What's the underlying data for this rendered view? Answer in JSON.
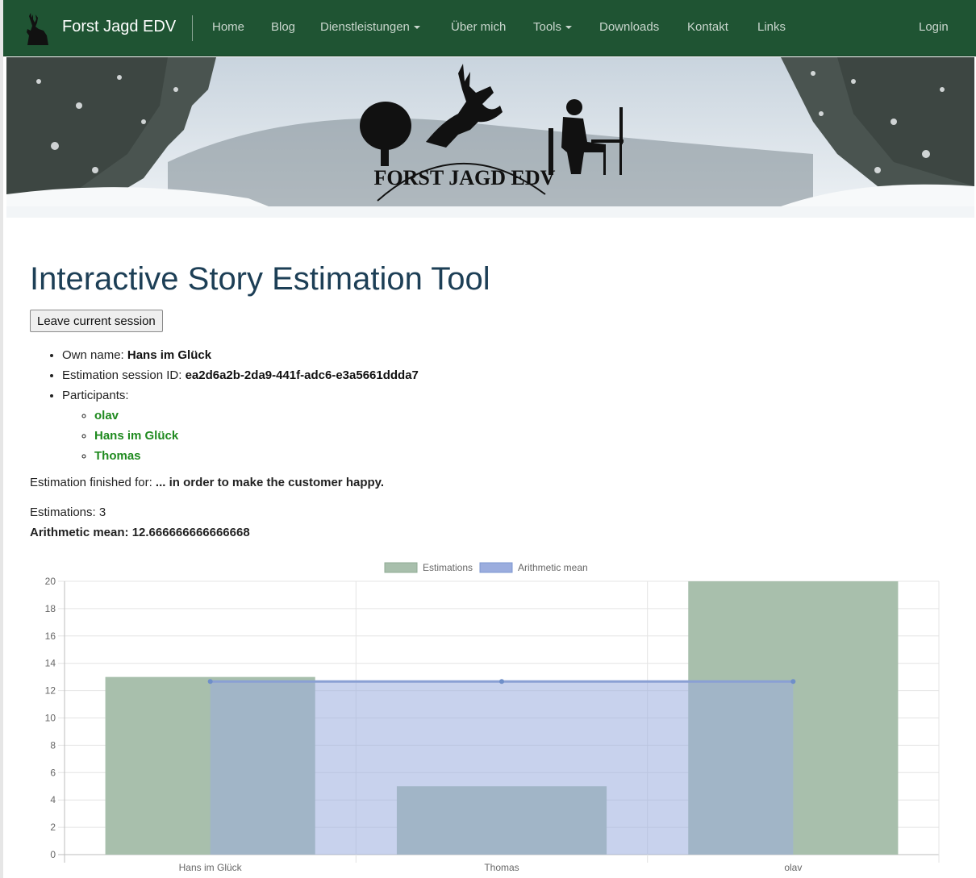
{
  "nav": {
    "brand": "Forst Jagd EDV",
    "items": [
      {
        "label": "Home",
        "dropdown": false
      },
      {
        "label": "Blog",
        "dropdown": false
      },
      {
        "label": "Dienstleistungen",
        "dropdown": true
      },
      {
        "label": "Über mich",
        "dropdown": false
      },
      {
        "label": "Tools",
        "dropdown": true
      },
      {
        "label": "Downloads",
        "dropdown": false
      },
      {
        "label": "Kontakt",
        "dropdown": false
      },
      {
        "label": "Links",
        "dropdown": false
      }
    ],
    "login": "Login"
  },
  "banner": {
    "logo_text": "FORST JAGD EDV"
  },
  "main": {
    "title": "Interactive Story Estimation Tool",
    "leave_button": "Leave current session",
    "own_name_label": "Own name:",
    "own_name": "Hans im Glück",
    "session_label": "Estimation session ID:",
    "session_id": "ea2d6a2b-2da9-441f-adc6-e3a5661ddda7",
    "participants_label": "Participants:",
    "participants": [
      "olav",
      "Hans im Glück",
      "Thomas"
    ],
    "finished_label": "Estimation finished for:",
    "finished_story": "... in order to make the customer happy.",
    "estimations_count": "Estimations: 3",
    "arithmetic_mean": "Arithmetic mean: 12.666666666666668"
  },
  "colors": {
    "navbar": "#1f5433",
    "title": "#1d3f56",
    "participant_link": "#1f8a1f",
    "series_estimations": "#a8bfac",
    "series_mean": "#9badde"
  },
  "chart_data": {
    "type": "bar",
    "categories": [
      "Hans im Glück",
      "Thomas",
      "olav"
    ],
    "series": [
      {
        "name": "Estimations",
        "type": "bar",
        "values": [
          13,
          5,
          20
        ]
      },
      {
        "name": "Arithmetic mean",
        "type": "area",
        "values": [
          12.666666666666668,
          12.666666666666668,
          12.666666666666668
        ]
      }
    ],
    "ylim": [
      0,
      20
    ],
    "yticks": [
      0,
      2,
      4,
      6,
      8,
      10,
      12,
      14,
      16,
      18,
      20
    ],
    "grid": true,
    "legend": "top-center"
  }
}
